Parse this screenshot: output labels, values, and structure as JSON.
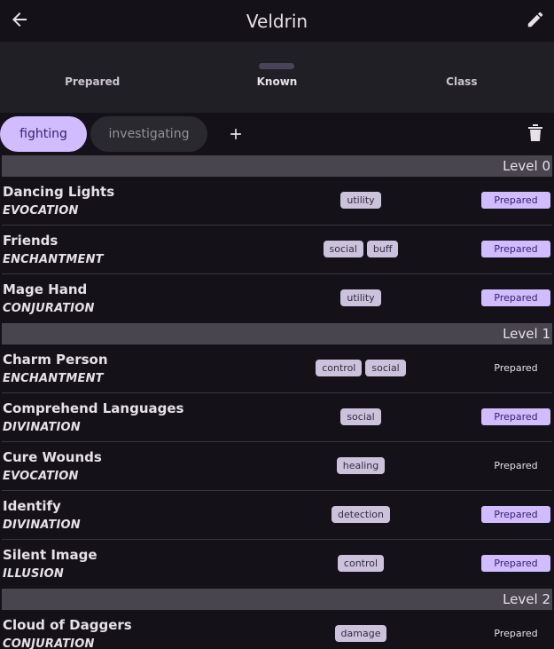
{
  "appbar": {
    "title": "Veldrin",
    "back_icon": "arrow-left-icon",
    "edit_icon": "pencil-icon"
  },
  "tabs": [
    {
      "label": "Prepared",
      "active": false
    },
    {
      "label": "Known",
      "active": true
    },
    {
      "label": "Class",
      "active": false
    }
  ],
  "filters": {
    "chips": [
      {
        "label": "fighting",
        "selected": true
      },
      {
        "label": "investigating",
        "selected": false
      }
    ],
    "add_icon": "plus-icon",
    "delete_icon": "trash-icon"
  },
  "colors": {
    "accent": "#d0bcff",
    "background": "#141218",
    "surface": "#211f26",
    "level_bar": "#49454f",
    "tag": "#ccc2dc"
  },
  "groups": [
    {
      "level": "Level 0",
      "spells": [
        {
          "name": "Dancing Lights",
          "school": "EVOCATION",
          "tags": [
            "utility"
          ],
          "status": "Prepared",
          "prepared": true
        },
        {
          "name": "Friends",
          "school": "ENCHANTMENT",
          "tags": [
            "social",
            "buff"
          ],
          "status": "Prepared",
          "prepared": true
        },
        {
          "name": "Mage Hand",
          "school": "CONJURATION",
          "tags": [
            "utility"
          ],
          "status": "Prepared",
          "prepared": true
        }
      ]
    },
    {
      "level": "Level 1",
      "spells": [
        {
          "name": "Charm Person",
          "school": "ENCHANTMENT",
          "tags": [
            "control",
            "social"
          ],
          "status": "Prepared",
          "prepared": false
        },
        {
          "name": "Comprehend Languages",
          "school": "DIVINATION",
          "tags": [
            "social"
          ],
          "status": "Prepared",
          "prepared": true
        },
        {
          "name": "Cure Wounds",
          "school": "EVOCATION",
          "tags": [
            "healing"
          ],
          "status": "Prepared",
          "prepared": false
        },
        {
          "name": "Identify",
          "school": "DIVINATION",
          "tags": [
            "detection"
          ],
          "status": "Prepared",
          "prepared": true
        },
        {
          "name": "Silent Image",
          "school": "ILLUSION",
          "tags": [
            "control"
          ],
          "status": "Prepared",
          "prepared": true
        }
      ]
    },
    {
      "level": "Level 2",
      "spells": [
        {
          "name": "Cloud of Daggers",
          "school": "CONJURATION",
          "tags": [
            "damage"
          ],
          "status": "Prepared",
          "prepared": false
        }
      ]
    }
  ]
}
